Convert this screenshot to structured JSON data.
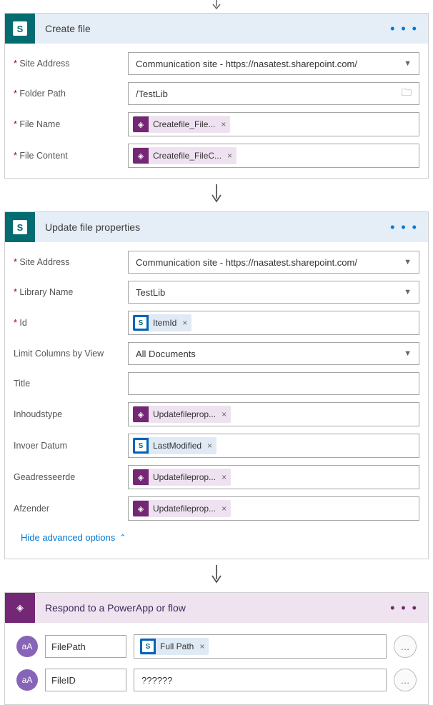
{
  "cards": {
    "create_file": {
      "title": "Create file",
      "fields": {
        "site_address": {
          "label": "Site Address",
          "value": "Communication site - https://nasatest.sharepoint.com/"
        },
        "folder_path": {
          "label": "Folder Path",
          "value": "/TestLib"
        },
        "file_name": {
          "label": "File Name",
          "token": "Createfile_File..."
        },
        "file_content": {
          "label": "File Content",
          "token": "Createfile_FileC..."
        }
      }
    },
    "update_props": {
      "title": "Update file properties",
      "fields": {
        "site_address": {
          "label": "Site Address",
          "value": "Communication site - https://nasatest.sharepoint.com/"
        },
        "library_name": {
          "label": "Library Name",
          "value": "TestLib"
        },
        "id": {
          "label": "Id",
          "token": "ItemId"
        },
        "limit_cols": {
          "label": "Limit Columns by View",
          "value": "All Documents"
        },
        "title_f": {
          "label": "Title",
          "value": ""
        },
        "inhoudstype": {
          "label": "Inhoudstype",
          "token": "Updatefileprop..."
        },
        "invoer_datum": {
          "label": "Invoer Datum",
          "token": "LastModified"
        },
        "geadresseerde": {
          "label": "Geadresseerde",
          "token": "Updatefileprop..."
        },
        "afzender": {
          "label": "Afzender",
          "token": "Updatefileprop..."
        }
      },
      "hide_advanced": "Hide advanced options"
    },
    "respond": {
      "title": "Respond to a PowerApp or flow",
      "outputs": {
        "filepath": {
          "name": "FilePath",
          "token": "Full Path"
        },
        "fileid": {
          "name": "FileID",
          "value": "??????"
        }
      }
    }
  }
}
